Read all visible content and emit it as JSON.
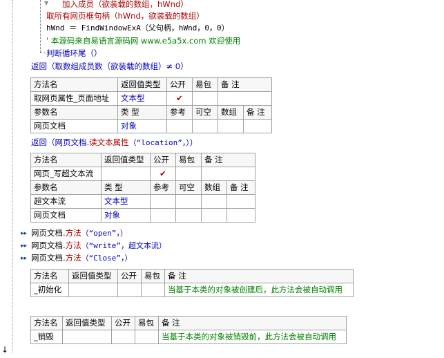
{
  "code": {
    "line1": "加入成员（欲装载的数组，hWnd）",
    "line2": "取所有网页框句柄（hWnd，欲装载的数组）",
    "line3": "hWnd ＝ FindWindowExA（父句柄，hWnd，0，0）",
    "line4": "' 本源码来自易语言源码网 www.e5a5x.com  欢迎使用",
    "line5": "判断循环尾（）",
    "line6": "返回（取数组成员数（欲装载的数组）≠ 0）",
    "line7_pre": "返回（网页文档.",
    "line7_method": "读文本属性",
    "line7_post": "（“location”，））",
    "call1_pre": "网页文档.",
    "call1_method": "方法",
    "call1_post": "（“open”，）",
    "call2_pre": "网页文档.",
    "call2_method": "方法",
    "call2_post": "（“write”，超文本流）",
    "call3_pre": "网页文档.",
    "call3_method": "方法",
    "call3_post": "（“Close”，）"
  },
  "table1": {
    "headers": [
      "方法名",
      "返回值类型",
      "公开",
      "易包",
      "备 注"
    ],
    "row": {
      "name": "取网页属性_页面地址",
      "ret": "文本型",
      "public": "✔",
      "pkg": "",
      "note": ""
    },
    "param_headers": [
      "参数名",
      "类 型",
      "参考",
      "可空",
      "数组",
      "备 注"
    ],
    "params": [
      {
        "name": "网页文档",
        "type": "对象",
        "ref": "",
        "nullable": "",
        "arr": "",
        "note": ""
      }
    ]
  },
  "table2": {
    "headers": [
      "方法名",
      "返回值类型",
      "公开",
      "易包",
      "备 注"
    ],
    "row": {
      "name": "网页_写超文本流",
      "ret": "",
      "public": "✔",
      "pkg": "",
      "note": ""
    },
    "param_headers": [
      "参数名",
      "类 型",
      "参考",
      "可空",
      "数组",
      "备 注"
    ],
    "params": [
      {
        "name": "超文本流",
        "type": "文本型",
        "ref": "",
        "nullable": "",
        "arr": "",
        "note": ""
      },
      {
        "name": "网页文档",
        "type": "对象",
        "ref": "",
        "nullable": "",
        "arr": "",
        "note": ""
      }
    ]
  },
  "table3": {
    "headers": [
      "方法名",
      "返回值类型",
      "公开",
      "易包",
      "备 注"
    ],
    "row": {
      "name": "_初始化",
      "ret": "",
      "public": "",
      "pkg": "",
      "note": "当基于本类的对象被创建后，此方法会被自动调用"
    }
  },
  "table4": {
    "headers": [
      "方法名",
      "返回值类型",
      "公开",
      "易包",
      "备 注"
    ],
    "row": {
      "name": "_销毁",
      "ret": "",
      "public": "",
      "pkg": "",
      "note": "当基于本类的对象被销毁前，此方法会被自动调用"
    }
  },
  "icons": {
    "gutter_arrow": "down-arrow-icon",
    "call_marker": "double-chevron-right-icon"
  },
  "colors": {
    "keyword": "#b00000",
    "type": "#0000c0",
    "comment": "#008000"
  }
}
